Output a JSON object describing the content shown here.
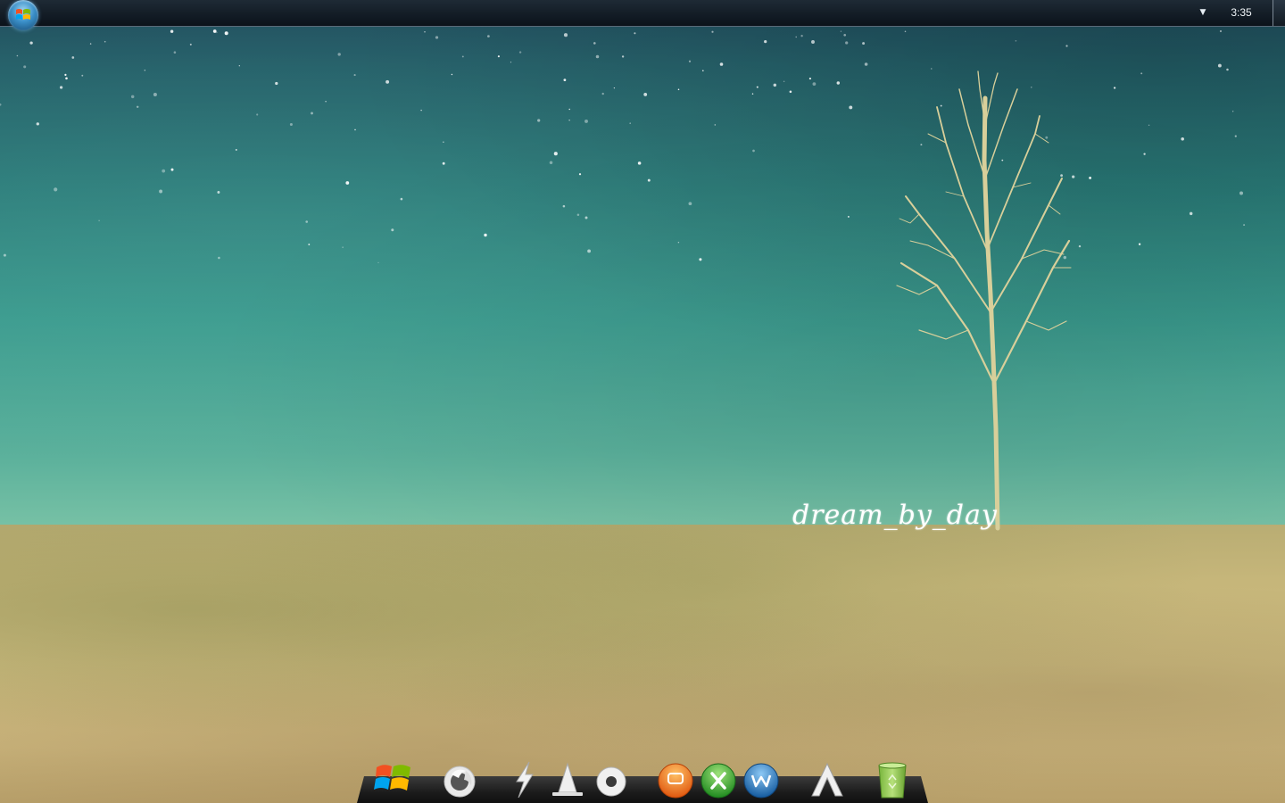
{
  "wallpaper": {
    "caption": "dream_by_day",
    "sky_color": "#2a7d7a",
    "ground_color": "#c6b67a"
  },
  "top_bar": {
    "start_icon": "windows-orb-icon",
    "tray_menu_icon": "triangle-down-icon",
    "clock_time": "3:35",
    "show_desktop_icon": "show-desktop-button"
  },
  "dock": {
    "items": [
      {
        "icon": "windows-logo-icon"
      },
      {
        "icon": "firefox-icon"
      },
      {
        "icon": "lightning-icon"
      },
      {
        "icon": "cone-icon"
      },
      {
        "icon": "disc-icon"
      },
      {
        "icon": "orange-app-icon"
      },
      {
        "icon": "xbox-icon"
      },
      {
        "icon": "word-icon"
      },
      {
        "icon": "a-logo-icon"
      },
      {
        "icon": "recycle-bin-icon"
      }
    ]
  }
}
